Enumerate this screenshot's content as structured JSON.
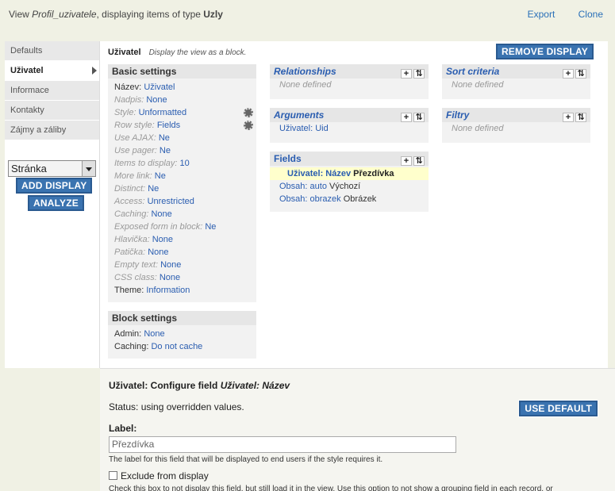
{
  "topbar": {
    "prefix": "View ",
    "view_name": "Profil_uzivatele",
    "middle": ", displaying items of type ",
    "type": "Uzly",
    "export": "Export",
    "clone": "Clone"
  },
  "tabs": [
    "Defaults",
    "Uživatel",
    "Informace",
    "Kontakty",
    "Zájmy a záliby"
  ],
  "display_select": "Stránka",
  "add_display": "ADD DISPLAY",
  "analyze": "ANALYZE",
  "display": {
    "name": "Uživatel",
    "description": "Display the view as a block.",
    "remove": "REMOVE DISPLAY"
  },
  "basic": {
    "title": "Basic settings",
    "rows": [
      {
        "k": "Název:",
        "v": "Uživatel"
      },
      {
        "k": "Nadpis:",
        "v": "None"
      },
      {
        "k": "Style:",
        "v": "Unformatted"
      },
      {
        "k": "Row style:",
        "v": "Fields"
      },
      {
        "k": "Use AJAX:",
        "v": "Ne"
      },
      {
        "k": "Use pager:",
        "v": "Ne"
      },
      {
        "k": "Items to display:",
        "v": "10"
      },
      {
        "k": "More link:",
        "v": "Ne"
      },
      {
        "k": "Distinct:",
        "v": "Ne"
      },
      {
        "k": "Access:",
        "v": "Unrestricted"
      },
      {
        "k": "Caching:",
        "v": "None"
      },
      {
        "k": "Exposed form in block:",
        "v": "Ne"
      },
      {
        "k": "Hlavička:",
        "v": "None"
      },
      {
        "k": "Patička:",
        "v": "None"
      },
      {
        "k": "Empty text:",
        "v": "None"
      },
      {
        "k": "CSS class:",
        "v": "None"
      },
      {
        "k": "Theme:",
        "v": "Information"
      }
    ]
  },
  "block": {
    "title": "Block settings",
    "admin_k": "Admin:",
    "admin_v": "None",
    "caching_k": "Caching:",
    "caching_v": "Do not cache"
  },
  "relationships": {
    "title": "Relationships",
    "empty": "None defined"
  },
  "sort": {
    "title": "Sort criteria",
    "empty": "None defined"
  },
  "arguments": {
    "title": "Arguments",
    "item": "Uživatel: Uid"
  },
  "filters": {
    "title": "Filtry",
    "empty": "None defined"
  },
  "fields": {
    "title": "Fields",
    "f1_link": "Uživatel: Název",
    "f1_label": "Přezdívka",
    "f2_link": "Obsah:",
    "f2_name": "auto",
    "f2_label": "Výchozí",
    "f3_link": "Obsah:",
    "f3_name": "obrazek",
    "f3_label": "Obrázek"
  },
  "ops": {
    "add": "+",
    "sort": "⇅"
  },
  "configure": {
    "title_prefix": "Uživatel: Configure field ",
    "title_field": "Uživatel: Název",
    "status": "Status: using overridden values.",
    "use_default": "USE DEFAULT",
    "label": "Label:",
    "label_value": "Přezdívka",
    "help": "The label for this field that will be displayed to end users if the style requires it.",
    "exclude": "Exclude from display",
    "exclude_help": "Check this box to not display this field, but still load it in the view. Use this option to not show a grouping field in each record, or"
  }
}
